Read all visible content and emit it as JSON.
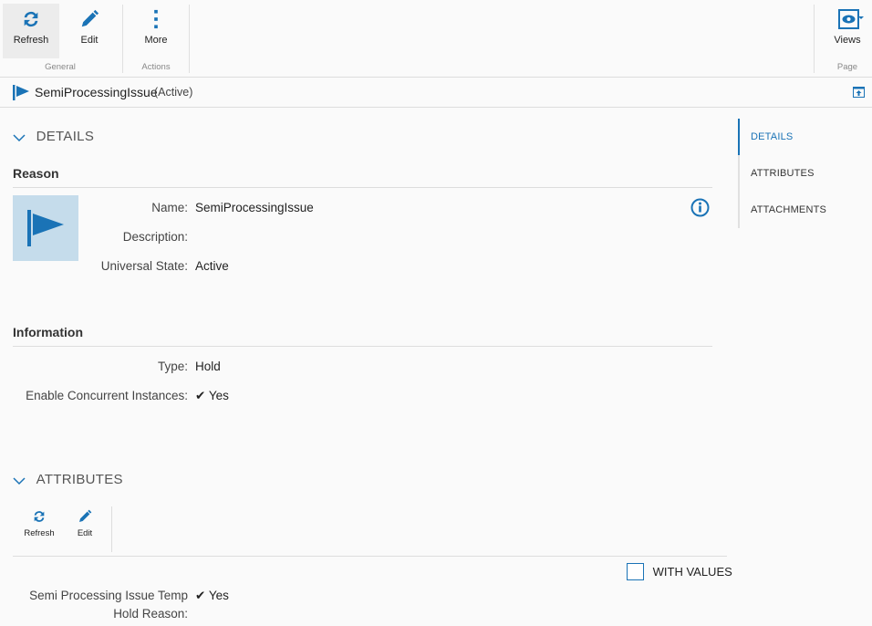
{
  "ribbon": {
    "refresh": "Refresh",
    "edit": "Edit",
    "more": "More",
    "views": "Views",
    "group_general": "General",
    "group_actions": "Actions",
    "group_page": "Page"
  },
  "title": {
    "name": "SemiProcessingIssue",
    "state": "(Active)"
  },
  "details": {
    "heading": "DETAILS",
    "reason": {
      "heading": "Reason",
      "name_label": "Name:",
      "name": "SemiProcessingIssue",
      "description_label": "Description:",
      "description": "",
      "universal_state_label": "Universal State:",
      "universal_state": "Active"
    },
    "information": {
      "heading": "Information",
      "type_label": "Type:",
      "type": "Hold",
      "concurrent_label": "Enable Concurrent Instances:",
      "concurrent": "Yes"
    }
  },
  "attributes": {
    "heading": "ATTRIBUTES",
    "refresh": "Refresh",
    "edit": "Edit",
    "with_values": "WITH VALUES",
    "attr_label_1": "Semi Processing Issue Temp",
    "attr_label_2": "Hold Reason:",
    "attr_value": "Yes"
  },
  "side_nav": [
    {
      "label": "DETAILS"
    },
    {
      "label": "ATTRIBUTES"
    },
    {
      "label": "ATTACHMENTS"
    }
  ],
  "colors": {
    "accent": "#1a73b6"
  }
}
